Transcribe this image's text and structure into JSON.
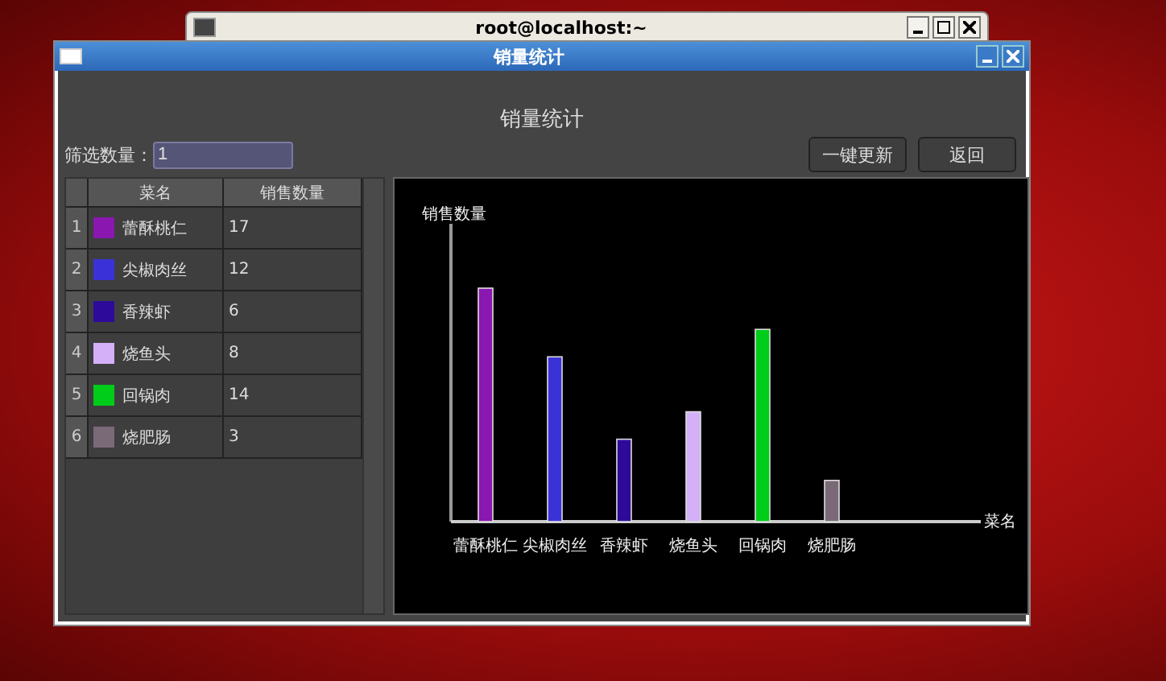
{
  "background_window": {
    "title": "root@localhost:~"
  },
  "window": {
    "title": "销量统计"
  },
  "heading": "销量统计",
  "filter": {
    "label": "筛选数量：",
    "value": "1"
  },
  "buttons": [
    "一键更新",
    "返回"
  ],
  "table": {
    "columns": [
      "菜名",
      "销售数量"
    ],
    "rows": [
      {
        "index": "1",
        "name": "蕾酥桃仁",
        "count": "17",
        "color": "#8a17b0"
      },
      {
        "index": "2",
        "name": "尖椒肉丝",
        "count": "12",
        "color": "#3a32d8"
      },
      {
        "index": "3",
        "name": "香辣虾",
        "count": "6",
        "color": "#2e0a9a"
      },
      {
        "index": "4",
        "name": "烧鱼头",
        "count": "8",
        "color": "#d4b0f8"
      },
      {
        "index": "5",
        "name": "回锅肉",
        "count": "14",
        "color": "#00cc1a"
      },
      {
        "index": "6",
        "name": "烧肥肠",
        "count": "3",
        "color": "#7a6a78"
      }
    ]
  },
  "chart": {
    "y_axis_title": "销售数量",
    "x_axis_title": "菜名",
    "category_labels": [
      "蕾酥桃仁",
      "尖椒肉丝",
      "香辣虾",
      "烧鱼头",
      "回锅肉",
      "烧肥肠"
    ]
  }
}
